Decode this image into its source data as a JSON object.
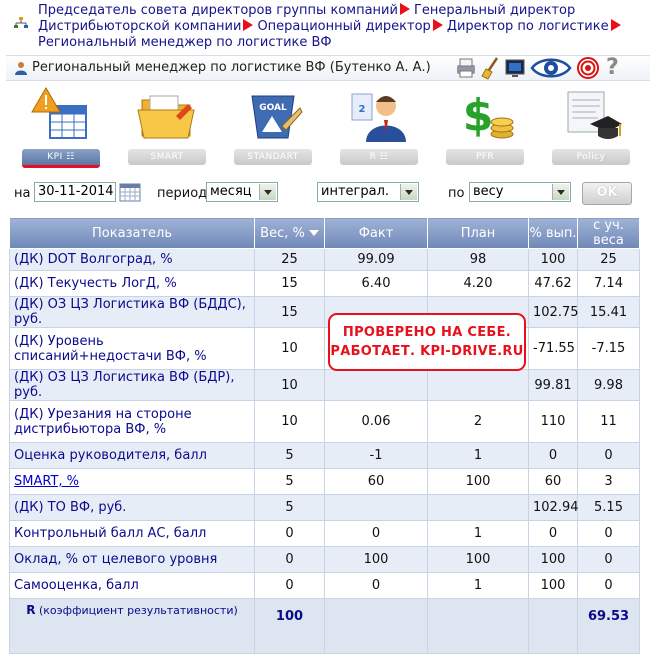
{
  "breadcrumb": {
    "items": [
      "Председатель совета директоров группы компаний",
      "Генеральный директор Дистрибьюторской компании",
      "Операционный директор",
      "Директор по логистике",
      "Региональный менеджер по логистике ВФ"
    ]
  },
  "user": {
    "title": "Региональный менеджер по логистике ВФ  (Бутенко А. А.)"
  },
  "toolbar": {
    "icons": [
      "printer-icon",
      "broom-icon",
      "screen-icon",
      "eye-icon",
      "target-icon",
      "help-icon"
    ],
    "help_glyph": "?"
  },
  "modules": [
    {
      "label": "KPI",
      "icon": "kpi-table-icon",
      "active": true
    },
    {
      "label": "SMART",
      "icon": "folder-icon",
      "active": false
    },
    {
      "label": "STANDART",
      "icon": "goal-icon",
      "active": false
    },
    {
      "label": "R",
      "icon": "person-icon",
      "active": false
    },
    {
      "label": "PFR",
      "icon": "money-icon",
      "active": false
    },
    {
      "label": "Policy",
      "icon": "scroll-cap-icon",
      "active": false
    }
  ],
  "filters": {
    "date_label": "на",
    "date_value": "30-11-2014",
    "period_label": "период",
    "period_value": "месяц",
    "mode_value": "интеграл.",
    "by_label": "по",
    "by_value": "весу",
    "ok_label": "OK"
  },
  "table": {
    "headers": [
      "Показатель",
      "Вес, %",
      "Факт",
      "План",
      "% вып.",
      "с уч. веса"
    ],
    "rows": [
      {
        "name": "(ДК) DOT Волгоград, %",
        "weight": "25",
        "fact": "99.09",
        "plan": "98",
        "pct": "100",
        "weighted": "25"
      },
      {
        "name": "(ДК) Текучесть ЛогД, %",
        "weight": "15",
        "fact": "6.40",
        "plan": "4.20",
        "pct": "47.62",
        "weighted": "7.14"
      },
      {
        "name": "(ДК) ОЗ ЦЗ Логистика ВФ (БДДС), руб.",
        "weight": "15",
        "fact": "",
        "plan": "",
        "pct": "102.75",
        "weighted": "15.41"
      },
      {
        "name": "(ДК) Уровень списаний+недостачи ВФ, %",
        "weight": "10",
        "fact": "",
        "plan": "",
        "pct": "-71.55",
        "weighted": "-7.15"
      },
      {
        "name": "(ДК) ОЗ ЦЗ Логистика ВФ (БДР), руб.",
        "weight": "10",
        "fact": "",
        "plan": "",
        "pct": "99.81",
        "weighted": "9.98"
      },
      {
        "name": "(ДК) Урезания на стороне дистрибьютора ВФ, %",
        "weight": "10",
        "fact": "0.06",
        "plan": "2",
        "pct": "110",
        "weighted": "11"
      },
      {
        "name": "Оценка руководителя, балл",
        "weight": "5",
        "fact": "-1",
        "plan": "1",
        "pct": "0",
        "weighted": "0"
      },
      {
        "name": "SMART, %",
        "weight": "5",
        "fact": "60",
        "plan": "100",
        "pct": "60",
        "weighted": "3",
        "link": true
      },
      {
        "name": "(ДК) ТО ВФ, руб.",
        "weight": "5",
        "fact": "",
        "plan": "",
        "pct": "102.94",
        "weighted": "5.15"
      },
      {
        "name": "Контрольный балл АС, балл",
        "weight": "0",
        "fact": "0",
        "plan": "1",
        "pct": "0",
        "weighted": "0"
      },
      {
        "name": "Оклад, % от целевого уровня",
        "weight": "0",
        "fact": "100",
        "plan": "100",
        "pct": "100",
        "weighted": "0"
      },
      {
        "name": "Самооценка, балл",
        "weight": "0",
        "fact": "0",
        "plan": "1",
        "pct": "100",
        "weighted": "0"
      }
    ],
    "total": {
      "label_r": "R",
      "label_rest": "(коэффициент результативности)",
      "weight": "100",
      "weighted": "69.53"
    }
  },
  "stamp": {
    "line1": "ПРОВЕРЕНО НА СЕБЕ.",
    "line2": "РАБОТАЕТ. KPI-DRIVE.RU"
  },
  "colors": {
    "header_blue": "#7f96c4",
    "accent_red": "#e8101a",
    "link_blue": "#0a0a8c"
  }
}
